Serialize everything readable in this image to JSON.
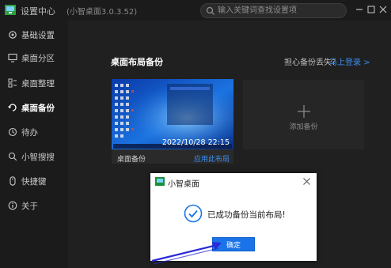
{
  "titlebar": {
    "title": "设置中心",
    "version": "(小智桌面3.0.3.52)",
    "search_placeholder": "输入关键词查找设置项"
  },
  "sidebar": {
    "items": [
      {
        "label": "基础设置",
        "icon": "settings-icon"
      },
      {
        "label": "桌面分区",
        "icon": "monitor-icon"
      },
      {
        "label": "桌面整理",
        "icon": "organize-icon"
      },
      {
        "label": "桌面备份",
        "icon": "backup-icon",
        "active": true
      },
      {
        "label": "待办",
        "icon": "clock-icon"
      },
      {
        "label": "小智搜搜",
        "icon": "search-icon"
      },
      {
        "label": "快捷键",
        "icon": "mouse-icon"
      },
      {
        "label": "关于",
        "icon": "info-icon"
      }
    ]
  },
  "main": {
    "section_title": "桌面布局备份",
    "worry_text": "担心备份丢失?",
    "login_link": "马上登录 >",
    "backup": {
      "timestamp": "2022/10/28 22:15",
      "name": "桌面备份",
      "apply": "应用此布局"
    },
    "add_label": "添加备份"
  },
  "dialog": {
    "title": "小智桌面",
    "message": "已成功备份当前布局!",
    "ok_label": "确定"
  },
  "colors": {
    "accent": "#1a73e8",
    "link": "#3b8ef0",
    "background": "#202020",
    "sidebar": "#1b1b1b",
    "annotation_arrow": "#2a2ad8"
  }
}
